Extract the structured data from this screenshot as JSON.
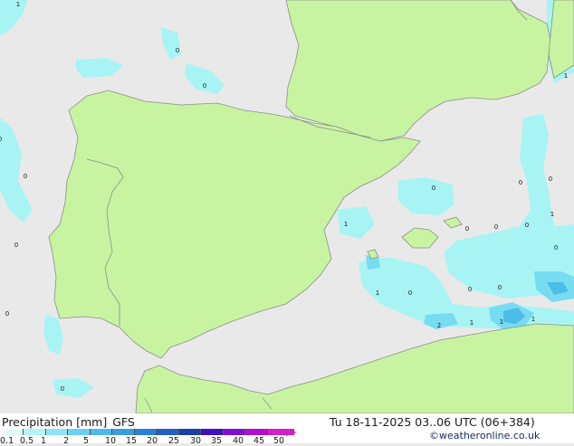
{
  "map": {
    "colors": {
      "sea": "#e9e9e9",
      "land": "#c8f4a2",
      "coast": "#8c8c8c",
      "precip_light": "#a8f4f4",
      "precip_mid": "#78dcf0",
      "precip_strong": "#4cbce8"
    },
    "precip_values": [
      {
        "value": "1",
        "region": "NW Atlantic"
      },
      {
        "value": "0",
        "region": "Bay of Biscay west"
      },
      {
        "value": "0",
        "region": "Bay of Biscay south"
      },
      {
        "value": "0",
        "region": "Atlantic west of Galicia"
      },
      {
        "value": "0",
        "region": "Atlantic west of Portugal"
      },
      {
        "value": "0",
        "region": "Atlantic west of Lisbon"
      },
      {
        "value": "0",
        "region": "Atlantic far west"
      },
      {
        "value": "0",
        "region": "Gulf of Cadiz"
      },
      {
        "value": "1",
        "region": "Gulf of Lion"
      },
      {
        "value": "0",
        "region": "Balearic Sea north"
      },
      {
        "value": "1",
        "region": "Valencia coast"
      },
      {
        "value": "0",
        "region": "Sardinia west"
      },
      {
        "value": "0",
        "region": "Sardinia south-west"
      },
      {
        "value": "1",
        "region": "Sardinia south"
      },
      {
        "value": "0",
        "region": "Balearic south"
      },
      {
        "value": "0",
        "region": "Central Med"
      },
      {
        "value": "0",
        "region": "Central Med east"
      },
      {
        "value": "0",
        "region": "Alboran Sea"
      },
      {
        "value": "1",
        "region": "Alboran Sea east"
      },
      {
        "value": "0",
        "region": "Algeria coast west"
      },
      {
        "value": "0",
        "region": "Algeria coast"
      },
      {
        "value": "0",
        "region": "Algeria coast east"
      },
      {
        "value": "2",
        "region": "Algeria Kabylie"
      },
      {
        "value": "1",
        "region": "Algeria east"
      },
      {
        "value": "1",
        "region": "Tunisia coast"
      },
      {
        "value": "1",
        "region": "Sardinia channel"
      }
    ]
  },
  "legend": {
    "title": "Precipitation [mm]",
    "model": "GFS",
    "date": "Tu 18-11-2025 03..06 UTC (06+384)",
    "credit": "©weatheronline.co.uk",
    "scale_labels": [
      "0.1",
      "0.5",
      "1",
      "2",
      "5",
      "10",
      "15",
      "20",
      "25",
      "30",
      "35",
      "40",
      "45",
      "50"
    ],
    "scale_colors": [
      "#e4fcfc",
      "#b4f4f8",
      "#90e4f4",
      "#6cd0f0",
      "#50b8ec",
      "#3c9ce0",
      "#2c80d4",
      "#2060c4",
      "#1840a8",
      "#4010c0",
      "#8010d0",
      "#b010d0",
      "#d020c8"
    ]
  }
}
